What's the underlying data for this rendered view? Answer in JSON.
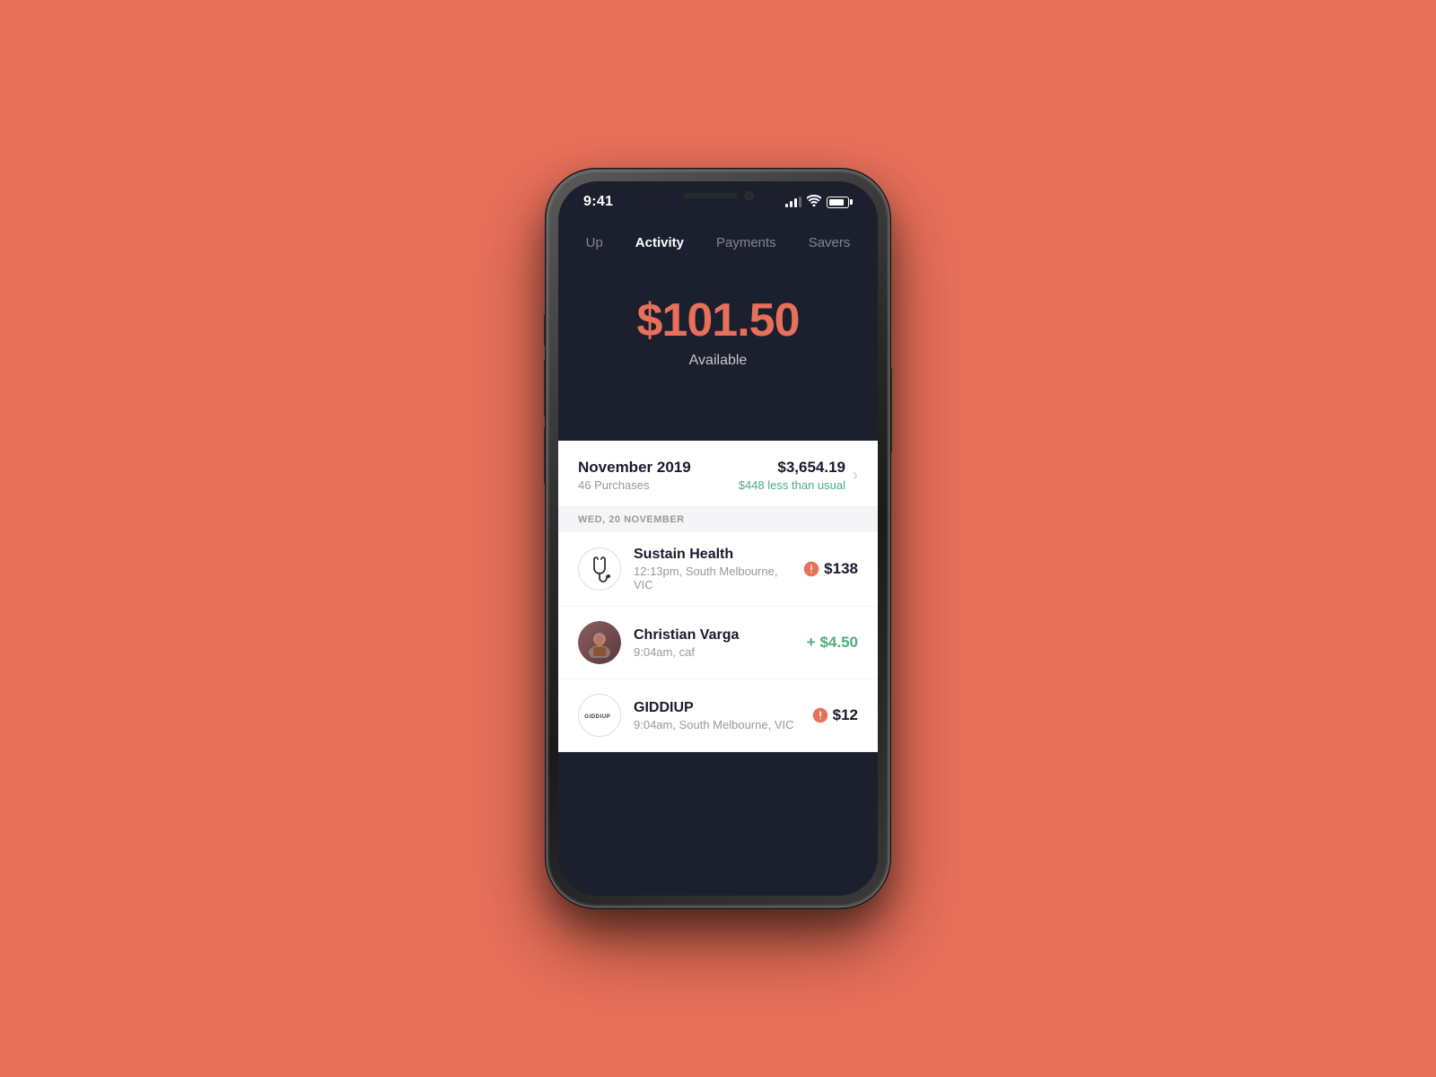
{
  "background_color": "#E8705A",
  "status_bar": {
    "time": "9:41"
  },
  "navigation": {
    "tabs": [
      {
        "label": "Up",
        "active": false
      },
      {
        "label": "Activity",
        "active": true
      },
      {
        "label": "Payments",
        "active": false
      },
      {
        "label": "Savers",
        "active": false,
        "truncated": true
      }
    ]
  },
  "balance": {
    "amount": "$101.50",
    "label": "Available"
  },
  "month_summary": {
    "month": "November 2019",
    "purchases": "46 Purchases",
    "total": "$3,654.19",
    "comparison": "$448 less than usual"
  },
  "date_separator": "WED, 20 NOVEMBER",
  "transactions": [
    {
      "id": 1,
      "name": "Sustain Health",
      "meta": "12:13pm, South Melbourne, VIC",
      "amount": "$138",
      "amount_type": "debit",
      "avatar_type": "stethoscope"
    },
    {
      "id": 2,
      "name": "Christian Varga",
      "meta": "9:04am, caf",
      "amount": "+ $4.50",
      "amount_type": "credit",
      "avatar_type": "person"
    },
    {
      "id": 3,
      "name": "GIDDIUP",
      "meta": "9:04am, South Melbourne, VIC",
      "amount": "$12",
      "amount_type": "debit",
      "avatar_type": "logo"
    }
  ]
}
